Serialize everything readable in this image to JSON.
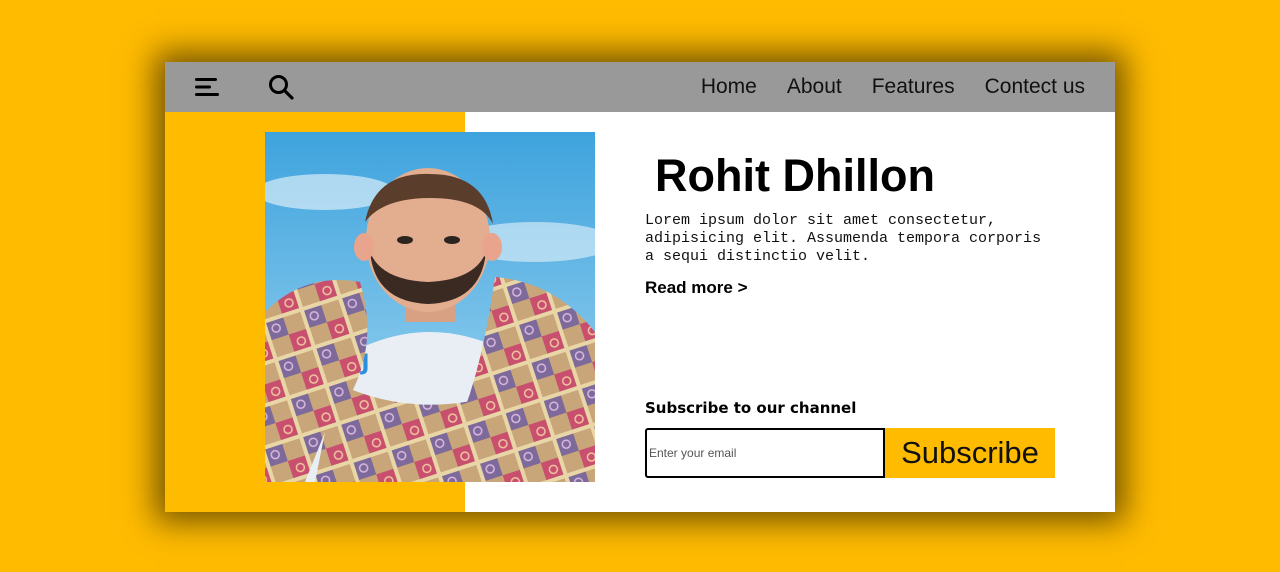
{
  "navbar": {
    "menu_icon": "hamburger-menu-icon",
    "search_icon": "search-icon",
    "links": [
      "Home",
      "About",
      "Features",
      "Contect us"
    ]
  },
  "profile": {
    "name": "Rohit Dhillon",
    "bio": "Lorem ipsum dolor sit amet consectetur, adipisicing elit. Assumenda tempora corporis a sequi distinctio velit.",
    "read_more": "Read more >"
  },
  "subscribe": {
    "heading": "Subscribe to our channel",
    "placeholder": "Enter your email",
    "button_label": "Subscribe"
  },
  "colors": {
    "accent": "#FFBB00",
    "navbar": "#999999",
    "card": "#FFFFFF"
  }
}
